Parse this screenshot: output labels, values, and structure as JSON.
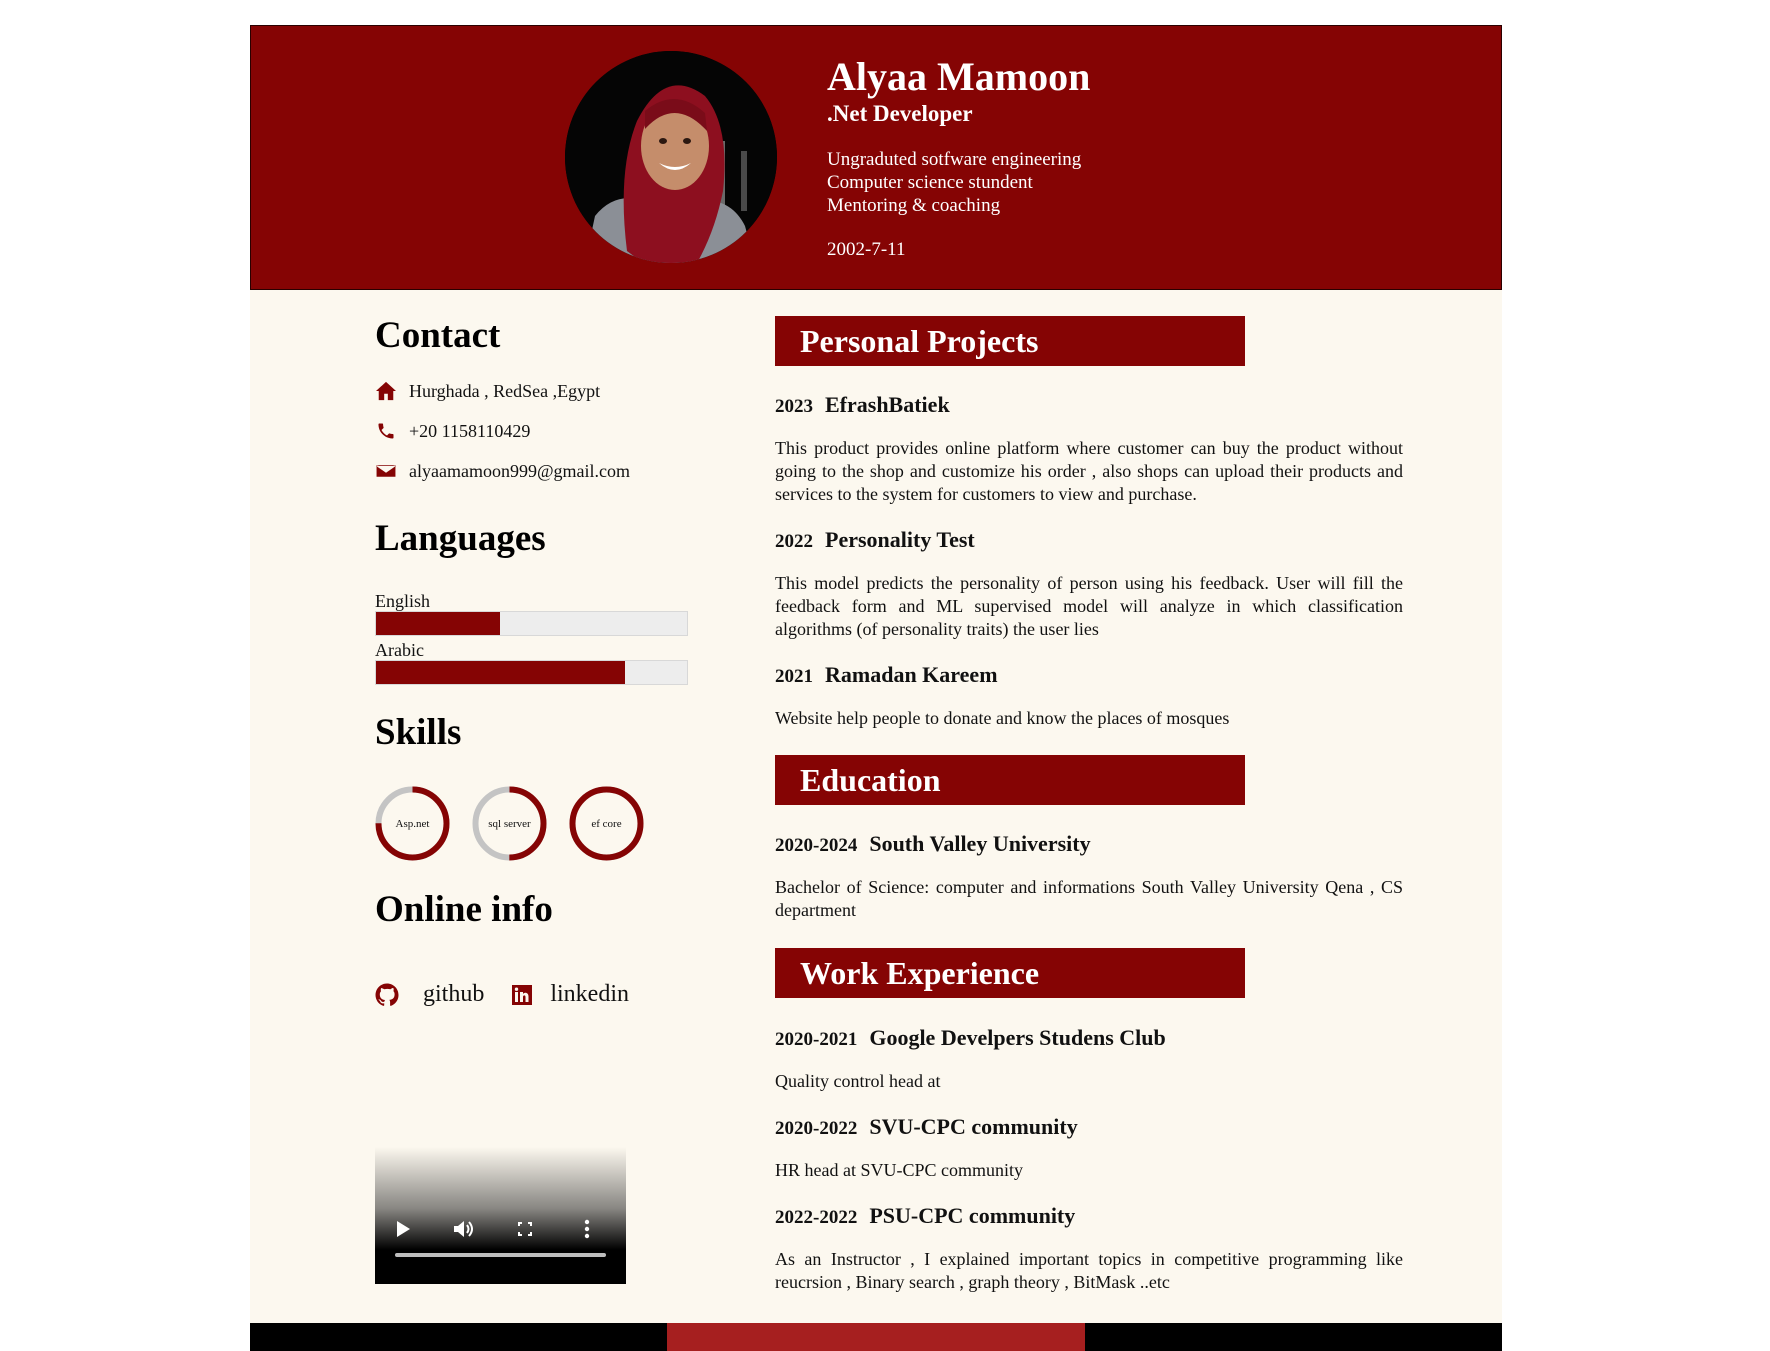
{
  "header": {
    "name": "Alyaa Mamoon",
    "role": ".Net Developer",
    "lines": [
      "Ungraduted sotfware engineering",
      "Computer science stundent",
      "Mentoring & coaching"
    ],
    "dob": "2002-7-11"
  },
  "contact": {
    "title": "Contact",
    "items": [
      {
        "icon": "home-icon",
        "text": "Hurghada , RedSea ,Egypt"
      },
      {
        "icon": "phone-icon",
        "text": "+20 1158110429"
      },
      {
        "icon": "envelope-icon",
        "text": "alyaamamoon999@gmail.com"
      }
    ]
  },
  "languages": {
    "title": "Languages",
    "items": [
      {
        "label": "English",
        "level": 0.4
      },
      {
        "label": "Arabic",
        "level": 0.8
      }
    ]
  },
  "skills": {
    "title": "Skills",
    "items": [
      {
        "label": "Asp.net",
        "level": 0.75
      },
      {
        "label": "sql server",
        "level": 0.5
      },
      {
        "label": "ef core",
        "level": 1.0
      }
    ]
  },
  "online": {
    "title": "Online info",
    "items": [
      {
        "icon": "github-icon",
        "label": "github"
      },
      {
        "icon": "linkedin-icon",
        "label": "linkedin"
      }
    ]
  },
  "projects": {
    "title": "Personal Projects",
    "items": [
      {
        "year": "2023",
        "name": "EfrashBatiek",
        "desc": "This product provides online platform where customer can buy the product without going to the shop and customize his order , also shops can upload their products and services to the system for customers to view and purchase."
      },
      {
        "year": "2022",
        "name": "Personality Test",
        "desc": "This model predicts the personality of person using his feedback. User will fill the feedback form and ML supervised model will analyze in which classification algorithms (of personality traits) the user lies"
      },
      {
        "year": "2021",
        "name": "Ramadan Kareem",
        "desc": "Website help people to donate and know the places of mosques"
      }
    ]
  },
  "education": {
    "title": "Education",
    "items": [
      {
        "year": "2020-2024",
        "name": "South Valley University",
        "desc": "Bachelor of Science: computer and informations South Valley University Qena , CS department"
      }
    ]
  },
  "work": {
    "title": "Work Experience",
    "items": [
      {
        "year": "2020-2021",
        "name": "Google Develpers Studens Club",
        "desc": "Quality control head at"
      },
      {
        "year": "2020-2022",
        "name": "SVU-CPC community",
        "desc": "HR head at SVU-CPC community"
      },
      {
        "year": "2022-2022",
        "name": "PSU-CPC community",
        "desc": "As an Instructor , I explained important topics in competitive programming like reucrsion , Binary search , graph theory , BitMask ..etc"
      }
    ]
  },
  "colors": {
    "accent": "#850404",
    "background": "#fcf8ef",
    "footer": [
      "#000000",
      "#a61f1f",
      "#000000"
    ]
  }
}
